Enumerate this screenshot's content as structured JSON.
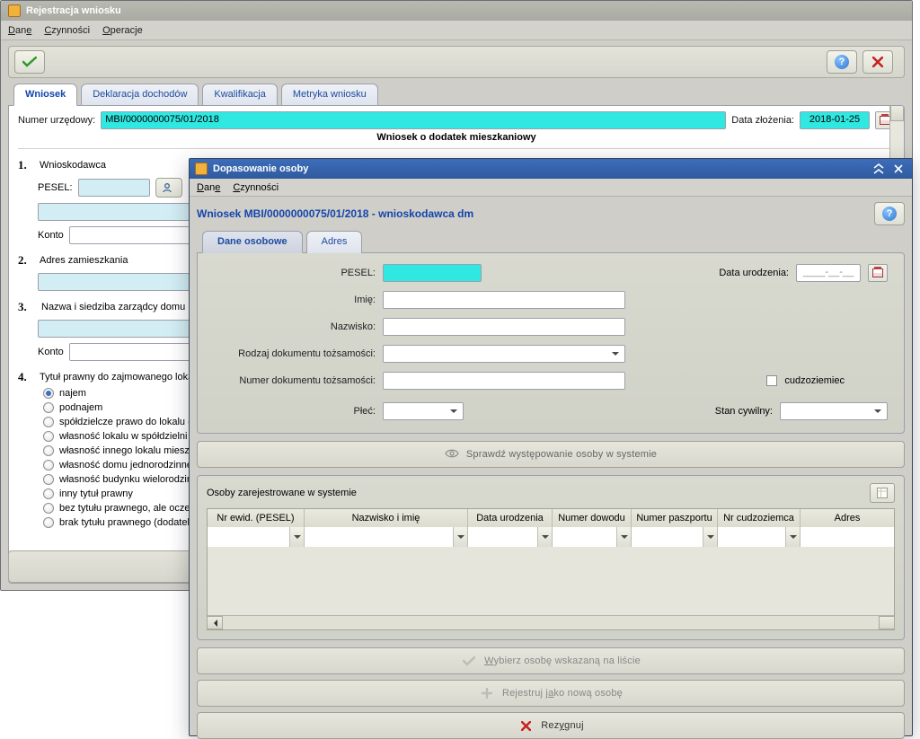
{
  "mainWindow": {
    "title": "Rejestracja wniosku",
    "menu": {
      "dane": "Dane",
      "czynnosci": "Czynności",
      "operacje": "Operacje"
    },
    "tabs": {
      "wniosek": "Wniosek",
      "deklaracja": "Deklaracja dochodów",
      "kwalifikacja": "Kwalifikacja",
      "metryka": "Metryka wniosku"
    },
    "numerLabel": "Numer urzędowy:",
    "numerValue": "MBI/0000000075/01/2018",
    "dataZlozeniaLabel": "Data złożenia:",
    "dataZlozeniaValue": "2018-01-25",
    "formTitle": "Wniosek o dodatek mieszkaniowy",
    "sec1": {
      "num": "1.",
      "label": "Wnioskodawca",
      "peselLabel": "PESEL:",
      "kontoLabel": "Konto"
    },
    "sec2": {
      "num": "2.",
      "label": "Adres zamieszkania"
    },
    "sec3": {
      "num": "3.",
      "label": "Nazwa i siedziba zarządcy domu",
      "kontoLabel": "Konto"
    },
    "sec4": {
      "num": "4.",
      "label": "Tytuł prawny do zajmowanego lokalu",
      "options": [
        "najem",
        "podnajem",
        "spółdzielcze prawo do lokalu (lokatorskie lub własnościowe)",
        "własność lokalu w spółdzielni mieszkaniowej",
        "własność innego lokalu mieszkalnego",
        "własność domu jednorodzinnego",
        "własność budynku wielorodzinnego, w którym zajmuje lokal",
        "inny tytuł prawny",
        "bez tytułu prawnego, ale oczekujący na dostarczenie przysługującego lokalu zamiennego lub socjalnego",
        "brak tytułu prawnego (dodatek nie przysługuje)"
      ]
    }
  },
  "modal": {
    "title": "Dopasowanie osoby",
    "menu": {
      "dane": "Dane",
      "czynnosci": "Czynności"
    },
    "heading": "Wniosek MBI/0000000075/01/2018 - wnioskodawca dm",
    "subTabs": {
      "daneOsobowe": "Dane osobowe",
      "adres": "Adres"
    },
    "form": {
      "pesel": "PESEL:",
      "dataUrodzenia": "Data urodzenia:",
      "dataUrodzeniaMask": "____-__-__",
      "imie": "Imię:",
      "nazwisko": "Nazwisko:",
      "rodzajDok": "Rodzaj dokumentu tożsamości:",
      "numerDok": "Numer dokumentu tożsamości:",
      "cudzoziemiec": "cudzoziemiec",
      "plec": "Płeć:",
      "stanCywilny": "Stan cywilny:"
    },
    "checkBtn": "Sprawdź występowanie osoby w systemie",
    "grid": {
      "title": "Osoby zarejestrowane w systemie",
      "cols": {
        "nrEwid": "Nr ewid. (PESEL)",
        "nazwisko": "Nazwisko i imię",
        "dataUr": "Data urodzenia",
        "nrDowodu": "Numer dowodu",
        "nrPaszportu": "Numer paszportu",
        "nrCudz": "Nr cudzoziemca",
        "adres": "Adres"
      }
    },
    "btnWybierz": "Wybierz osobę wskazaną na liście",
    "btnRejestruj": "Rejestruj jako nową osobę",
    "btnRezygnuj": "Rezygnuj"
  }
}
